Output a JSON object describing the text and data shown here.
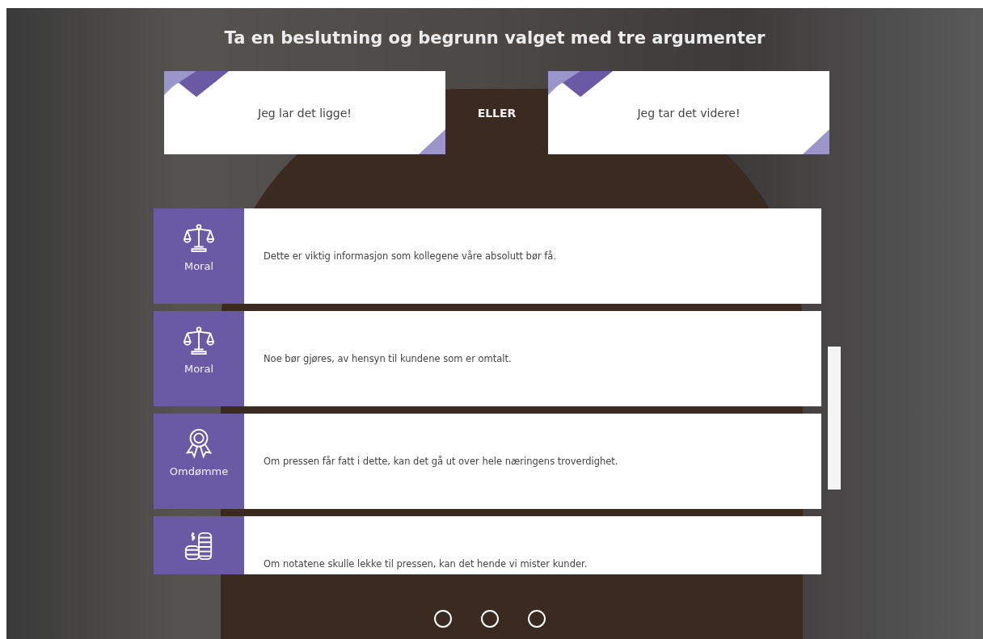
{
  "title": "Ta en beslutning og begrunn valget med tre argumenter",
  "choices": [
    {
      "label": "Jeg lar det ligge!"
    },
    {
      "label": "Jeg tar det videre!"
    }
  ],
  "separator": "ELLER",
  "arguments": [
    {
      "kind": "moral",
      "category": "Moral",
      "text": "Dette er viktig informasjon som kollegene våre absolutt bør få."
    },
    {
      "kind": "moral",
      "category": "Moral",
      "text": "Noe bør gjøres, av hensyn til kundene som er omtalt."
    },
    {
      "kind": "reputation",
      "category": "Omdømme",
      "text": "Om pressen får fatt i dette, kan det gå ut over hele næringens troverdighet."
    },
    {
      "kind": "money",
      "text": "Om notatene skulle lekke til pressen, kan det hende vi mister kunder."
    }
  ],
  "pages": [
    {
      "selected": false
    },
    {
      "selected": false
    },
    {
      "selected": false
    }
  ]
}
